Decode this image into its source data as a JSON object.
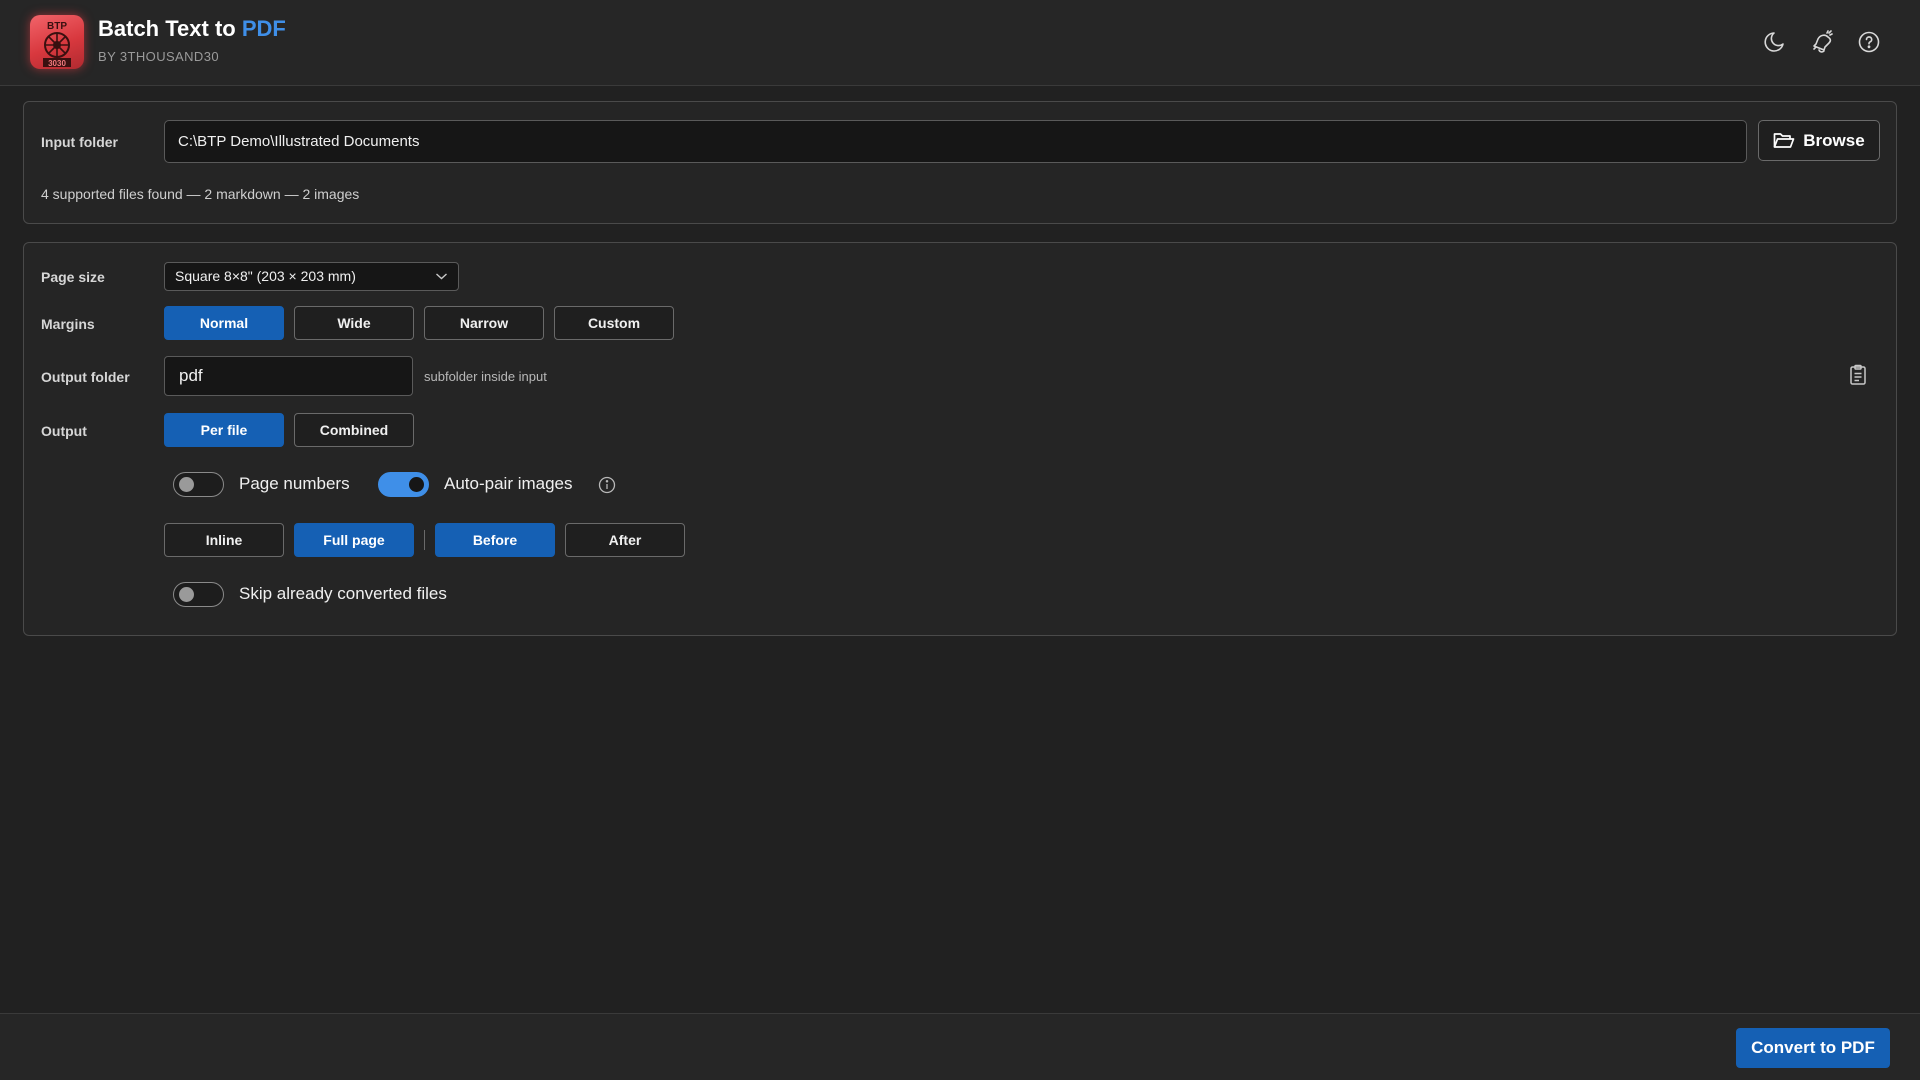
{
  "app": {
    "title_main": "Batch Text to ",
    "title_accent": "PDF",
    "subtitle": "BY 3THOUSAND30",
    "logo_text_top": "BTP",
    "logo_text_bottom": "3030"
  },
  "header_icons": [
    "moon-icon",
    "bell-icon",
    "help-icon"
  ],
  "input": {
    "label": "Input folder",
    "path": "C:\\BTP Demo\\Illustrated Documents",
    "browse_label": "Browse",
    "status": "4 supported files found — 2 markdown — 2 images"
  },
  "settings": {
    "page_size_label": "Page size",
    "page_size_value": "Square 8×8\" (203 × 203 mm)",
    "margins_label": "Margins",
    "margins_options": [
      "Normal",
      "Wide",
      "Narrow",
      "Custom"
    ],
    "margins_selected": "Normal",
    "output_folder_label": "Output folder",
    "output_folder_value": "pdf",
    "output_folder_hint": "subfolder inside input",
    "output_label": "Output",
    "output_options": [
      "Per file",
      "Combined"
    ],
    "output_selected": "Per file",
    "page_numbers_label": "Page numbers",
    "page_numbers_on": false,
    "auto_pair_label": "Auto-pair images",
    "auto_pair_on": true,
    "image_layout_options": [
      "Inline",
      "Full page"
    ],
    "image_layout_selected": "Full page",
    "image_position_options": [
      "Before",
      "After"
    ],
    "image_position_selected": "Before",
    "skip_label": "Skip already converted files",
    "skip_on": false
  },
  "footer": {
    "convert_label": "Convert to PDF"
  },
  "colors": {
    "accent": "#3f8fe8",
    "button_active": "#1560b4",
    "background": "#212121",
    "logo": "#e0454a"
  }
}
